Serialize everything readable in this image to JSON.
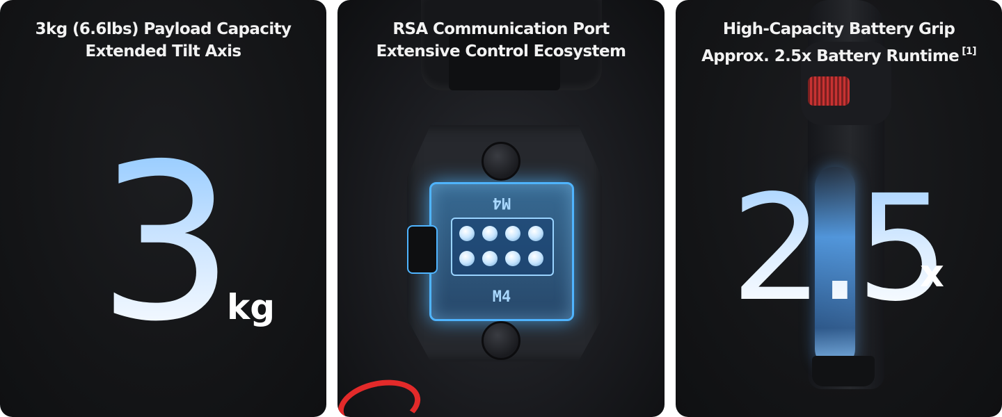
{
  "panels": [
    {
      "title_line1": "3kg (6.6lbs) Payload Capacity",
      "title_line2": "Extended Tilt Axis",
      "big_value": "3",
      "unit": "kg"
    },
    {
      "title_line1": "RSA Communication Port",
      "title_line2": "Extensive Control Ecosystem",
      "port_label": "M4"
    },
    {
      "title_line1": "High-Capacity Battery Grip",
      "title_line2": "Approx. 2.5x Battery Runtime",
      "footnote": "[1]",
      "big_value": "2.5",
      "unit": "x"
    }
  ],
  "colors": {
    "panel_background": "#141517",
    "number_gradient_top": "#8ec8ff",
    "number_gradient_bottom": "#ffffff",
    "port_glow": "#4fb4ff",
    "accent_red": "#e32a2a"
  }
}
